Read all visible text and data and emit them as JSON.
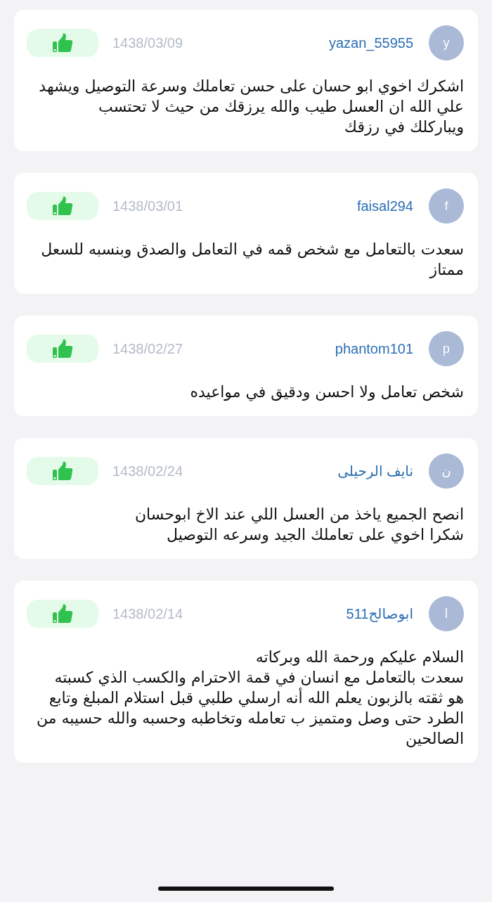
{
  "reviews": [
    {
      "avatar_letter": "y",
      "username": "yazan_55955",
      "date": "1438/03/09",
      "text": "اشكرك اخوي ابو حسان على حسن تعاملك وسرعة التوصيل ويشهد علي الله ان العسل طيب والله يرزقك من حيث لا تحتسب  ويباركلك في رزقك"
    },
    {
      "avatar_letter": "f",
      "username": "faisal294",
      "date": "1438/03/01",
      "text": "سعدت بالتعامل مع شخص قمه في التعامل والصدق وبنسبه للسعل ممتاز"
    },
    {
      "avatar_letter": "p",
      "username": "phantom101",
      "date": "1438/02/27",
      "text": "شخص تعامل ولا احسن ودقيق في مواعيده"
    },
    {
      "avatar_letter": "ن",
      "username": "نايف الرحيلى",
      "date": "1438/02/24",
      "text": "انصح الجميع ياخذ من العسل اللي عند الاخ ابوحسان\nشكرا اخوي على تعاملك الجيد وسرعه التوصيل"
    },
    {
      "avatar_letter": "ا",
      "username": "ابوصالح511",
      "date": "1438/02/14",
      "text": "السلام عليكم ورحمة الله وبركاته\nسعدت بالتعامل مع انسان في قمة الاحترام والكسب الذي كسبته هو ثقته بالزبون يعلم الله أنه ارسلي طلبي قبل استلام المبلغ وتابع الطرد حتى وصل ومتميز ب تعامله وتخاطبه وحسبه والله حسيبه من الصالحين"
    }
  ]
}
